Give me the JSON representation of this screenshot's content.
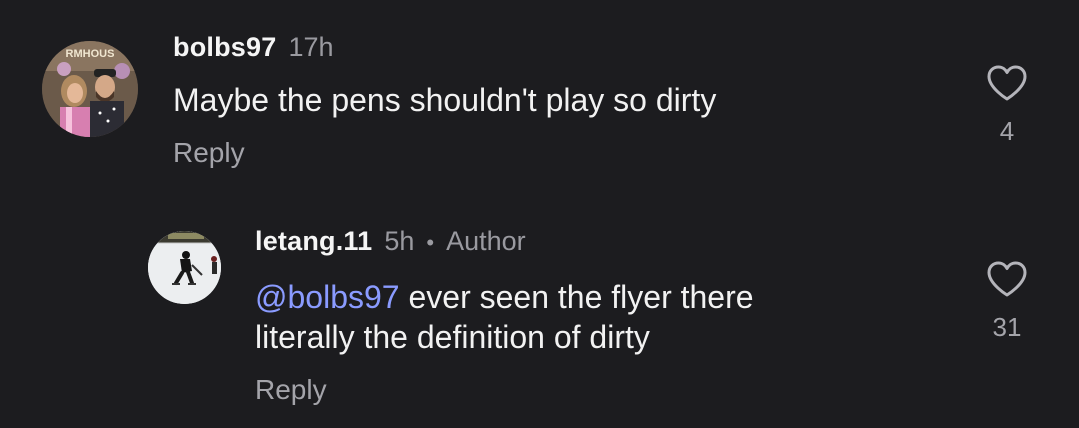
{
  "comments": [
    {
      "username": "bolbs97",
      "time": "17h",
      "text": "Maybe the pens shouldn't play so dirty",
      "reply_label": "Reply",
      "like_count": "4",
      "avatar_sign_text": "RMHOUS"
    },
    {
      "username": "letang.11",
      "time": "5h",
      "separator": "•",
      "author_badge": "Author",
      "mention": "@bolbs97",
      "text_line1": " ever seen the flyer there",
      "text_line2": "literally the definition of dirty",
      "reply_label": "Reply",
      "like_count": "31"
    }
  ],
  "colors": {
    "background": "#1c1c1f",
    "mention": "#8a9bff",
    "secondary_text": "#9a9aa0"
  }
}
